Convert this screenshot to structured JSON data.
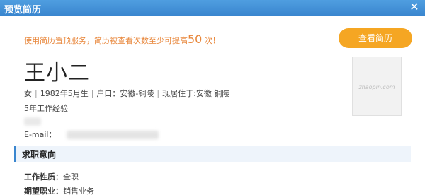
{
  "window": {
    "title": "预览简历",
    "close_glyph": "✕"
  },
  "promo": {
    "prefix": "使用简历置顶服务，简历被查看次数至少可提高",
    "number": "50",
    "suffix": " 次！"
  },
  "actions": {
    "preview_label": "查看简历"
  },
  "profile": {
    "name": "王小二",
    "gender": "女",
    "birth": "1982年5月生",
    "hukou": "户口：安徽-铜陵",
    "residence": "现居住于:安徽 铜陵",
    "experience": "5年工作经验",
    "email_label": "E-mail："
  },
  "photo": {
    "watermark": "zhaopin.com"
  },
  "section": {
    "title": "求职意向"
  },
  "intent": {
    "type_label": "工作性质：",
    "type_value": "全职",
    "role_label": "期望职业：",
    "role_value": "销售业务"
  }
}
